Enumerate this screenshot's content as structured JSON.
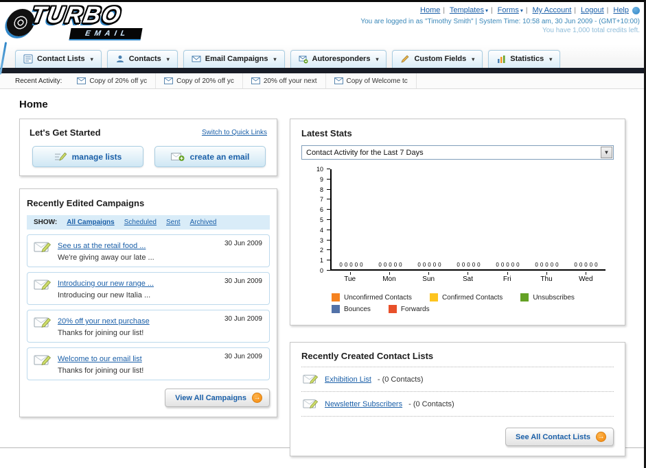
{
  "colors": {
    "link_blue": "#1a5fa8",
    "navy_bar": "#181c26",
    "accent_orange": "#f7941d",
    "tab_border": "#a9cde2",
    "panel_border": "#c6c6c6"
  },
  "header": {
    "logo_title": "TURBO",
    "logo_subtitle": "EMAIL",
    "nav_links": [
      {
        "label": "Home",
        "arrow": false
      },
      {
        "label": "Templates",
        "arrow": true
      },
      {
        "label": "Forms",
        "arrow": true
      },
      {
        "label": "My Account",
        "arrow": false
      },
      {
        "label": "Logout",
        "arrow": false
      },
      {
        "label": "Help",
        "arrow": false
      }
    ],
    "login_info": "You are logged in as \"Timothy Smith\" | System Time: 10:58 am, 30 Jun 2009 - (GMT+10:00)",
    "credits_info": "You have 1,000 total credits left."
  },
  "nav_tabs": [
    {
      "label": "Contact Lists",
      "icon": "contact-lists-icon"
    },
    {
      "label": "Contacts",
      "icon": "contacts-icon"
    },
    {
      "label": "Email Campaigns",
      "icon": "email-campaigns-icon"
    },
    {
      "label": "Autoresponders",
      "icon": "autoresponders-icon"
    },
    {
      "label": "Custom Fields",
      "icon": "custom-fields-icon"
    },
    {
      "label": "Statistics",
      "icon": "statistics-icon"
    }
  ],
  "recent_activity": {
    "label": "Recent Activity:",
    "items": [
      "Copy of 20% off yc",
      "Copy of 20% off yc",
      "20% off your next",
      "Copy of Welcome tc"
    ]
  },
  "page_title": "Home",
  "get_started": {
    "title": "Let's Get Started",
    "switch_link": "Switch to Quick Links",
    "manage_lists_button": "manage lists",
    "create_email_button": "create an email"
  },
  "campaigns": {
    "title": "Recently Edited Campaigns",
    "show_label": "SHOW:",
    "filters": [
      "All Campaigns",
      "Scheduled",
      "Sent",
      "Archived"
    ],
    "items": [
      {
        "title": "See us at the retail food ...",
        "subtitle": "We're giving away our late ...",
        "date": "30 Jun 2009"
      },
      {
        "title": "Introducing our new range ...",
        "subtitle": "Introducing our new Italia ...",
        "date": "30 Jun 2009"
      },
      {
        "title": "20% off your next purchase",
        "subtitle": "Thanks for joining our list!",
        "date": "30 Jun 2009"
      },
      {
        "title": "Welcome to our email list",
        "subtitle": "Thanks for joining our list!",
        "date": "30 Jun 2009"
      }
    ],
    "view_all_button": "View All Campaigns"
  },
  "latest_stats": {
    "title": "Latest Stats",
    "dropdown_value": "Contact Activity for the Last 7 Days",
    "legend": [
      {
        "label": "Unconfirmed Contacts",
        "color": "#f58220"
      },
      {
        "label": "Confirmed Contacts",
        "color": "#fdc41f"
      },
      {
        "label": "Unsubscribes",
        "color": "#64a125"
      },
      {
        "label": "Bounces",
        "color": "#5272a8"
      },
      {
        "label": "Forwards",
        "color": "#e8502a"
      }
    ]
  },
  "chart_data": {
    "type": "bar",
    "title": "Contact Activity for the Last 7 Days",
    "categories": [
      "Tue",
      "Mon",
      "Sun",
      "Sat",
      "Fri",
      "Thu",
      "Wed"
    ],
    "series": [
      {
        "name": "Unconfirmed Contacts",
        "color": "#f58220",
        "values": [
          0,
          0,
          0,
          0,
          0,
          0,
          0
        ]
      },
      {
        "name": "Confirmed Contacts",
        "color": "#fdc41f",
        "values": [
          0,
          0,
          0,
          0,
          0,
          0,
          0
        ]
      },
      {
        "name": "Unsubscribes",
        "color": "#64a125",
        "values": [
          0,
          0,
          0,
          0,
          0,
          0,
          0
        ]
      },
      {
        "name": "Bounces",
        "color": "#5272a8",
        "values": [
          0,
          0,
          0,
          0,
          0,
          0,
          0
        ]
      },
      {
        "name": "Forwards",
        "color": "#e8502a",
        "values": [
          0,
          0,
          0,
          0,
          0,
          0,
          0
        ]
      }
    ],
    "ylim": [
      0,
      10
    ],
    "ytick_step": 1,
    "grid": false,
    "legend_position": "bottom"
  },
  "contact_lists": {
    "title": "Recently Created Contact Lists",
    "items": [
      {
        "name": "Exhibition List",
        "detail": "- (0 Contacts)"
      },
      {
        "name": "Newsletter Subscribers",
        "detail": "- (0 Contacts)"
      }
    ],
    "see_all_button": "See All Contact Lists"
  }
}
